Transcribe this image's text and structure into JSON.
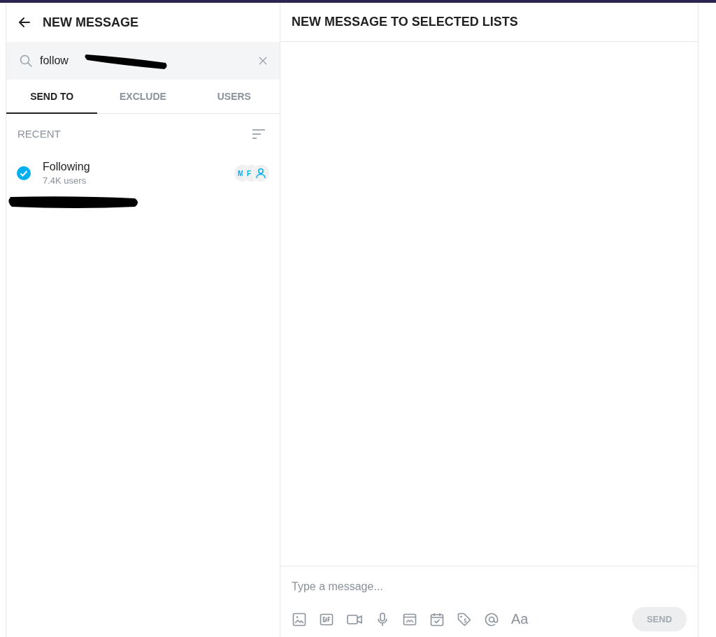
{
  "left_panel": {
    "title": "NEW MESSAGE",
    "search": {
      "value": "follow"
    },
    "tabs": [
      {
        "label": "SEND TO",
        "selected": true
      },
      {
        "label": "EXCLUDE",
        "selected": false
      },
      {
        "label": "USERS",
        "selected": false
      }
    ],
    "section_label": "RECENT",
    "lists": [
      {
        "name": "Following",
        "count": "7.4K users",
        "checked": true,
        "avatars": [
          {
            "kind": "initial",
            "text": "M"
          },
          {
            "kind": "initial",
            "text": "F"
          },
          {
            "kind": "person"
          }
        ]
      }
    ]
  },
  "right_panel": {
    "title": "NEW MESSAGE TO SELECTED LISTS",
    "composer": {
      "placeholder": "Type a message...",
      "tools": [
        {
          "kind": "image"
        },
        {
          "kind": "gif"
        },
        {
          "kind": "video"
        },
        {
          "kind": "mic"
        },
        {
          "kind": "vault"
        },
        {
          "kind": "schedule"
        },
        {
          "kind": "price"
        },
        {
          "kind": "mention"
        },
        {
          "kind": "text",
          "text": "Aa"
        }
      ],
      "send": {
        "label": "SEND",
        "disabled": true
      }
    }
  }
}
